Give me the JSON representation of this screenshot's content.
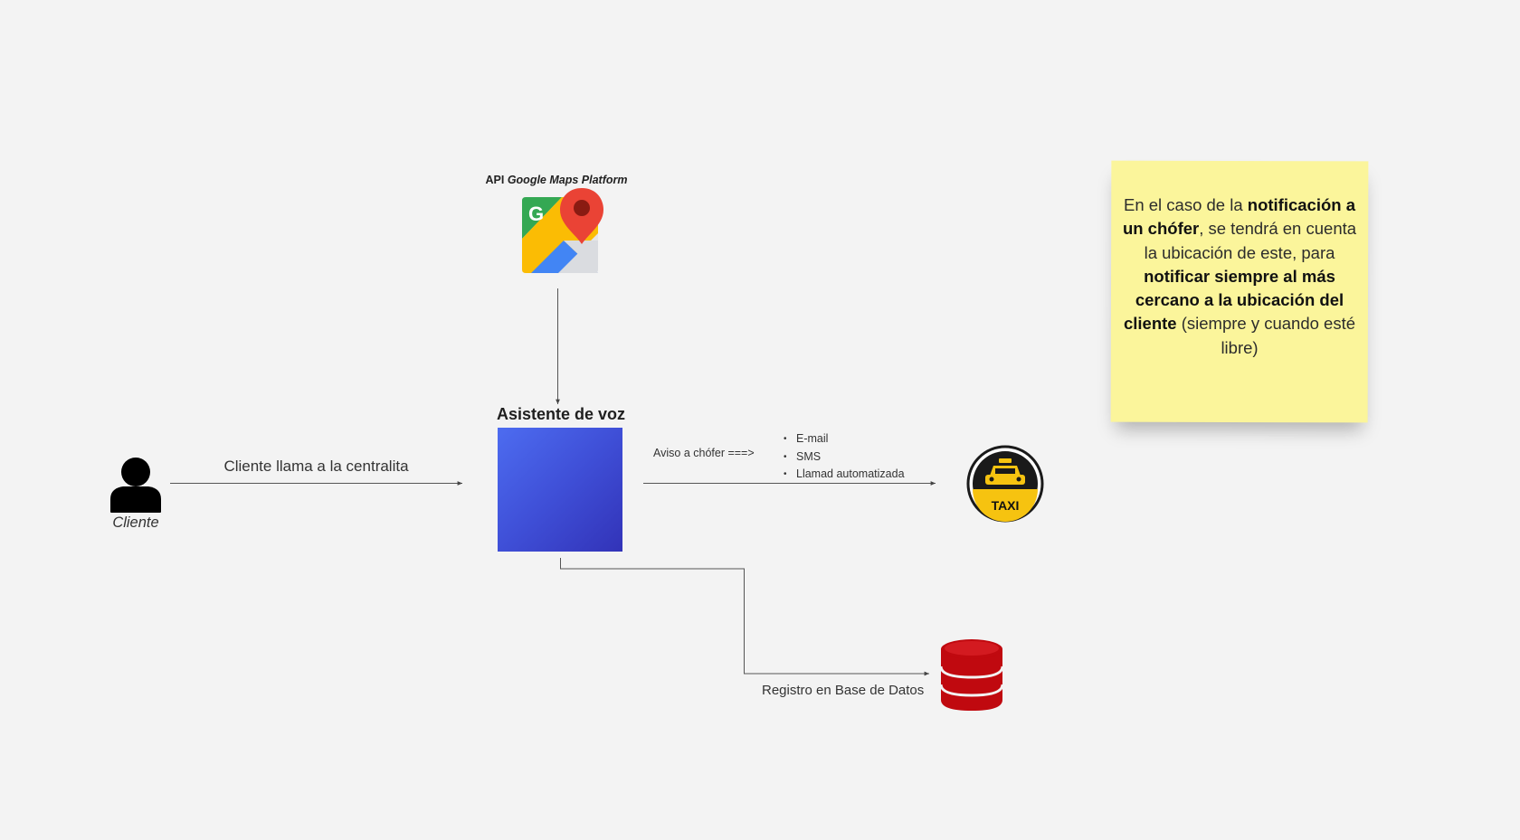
{
  "maps": {
    "label_prefix": "API",
    "label_emphasis": "Google Maps Platform",
    "icon": "google-maps-icon"
  },
  "assistant": {
    "title": "Asistente de voz",
    "icon": "cloud-chat-analytics-icon",
    "colors": [
      "#4d6cf0",
      "#3233b8"
    ]
  },
  "client": {
    "icon": "user-silhouette-icon",
    "name": "Cliente",
    "call_label": "Cliente llama a la centralita"
  },
  "driver_notice": {
    "label": "Aviso a chófer ===>",
    "channels": [
      "E-mail",
      "SMS",
      "Llamad automatizada"
    ]
  },
  "taxi": {
    "icon": "taxi-badge-icon",
    "badge_text": "TAXI",
    "colors": [
      "#1a1a1a",
      "#f6c310"
    ]
  },
  "database": {
    "label": "Registro en Base de Datos",
    "icon": "database-icon",
    "color": "#c0090f"
  },
  "note": {
    "color": "#fbf59b",
    "parts": [
      {
        "text": "En el caso de la ",
        "bold": false
      },
      {
        "text": "notificación a un chófer",
        "bold": true
      },
      {
        "text": ", se tendrá en cuenta la ubicación de este, para ",
        "bold": false
      },
      {
        "text": "notificar siempre al más cercano a la ubicación del cliente",
        "bold": true
      },
      {
        "text": " (siempre y cuando esté libre)",
        "bold": false
      }
    ]
  }
}
